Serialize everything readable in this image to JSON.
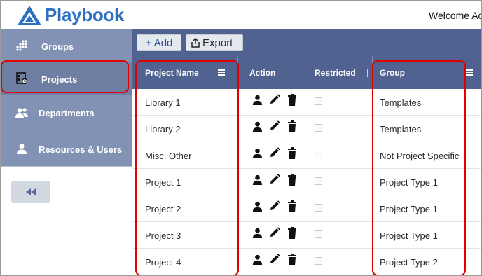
{
  "header": {
    "brand": "Playbook",
    "welcome": "Welcome Acc"
  },
  "sidebar": {
    "items": [
      {
        "label": "Groups",
        "icon": "groups-icon"
      },
      {
        "label": "Projects",
        "icon": "projects-icon"
      },
      {
        "label": "Departments",
        "icon": "departments-icon"
      },
      {
        "label": "Resources & Users",
        "icon": "user-icon"
      }
    ],
    "active": "Projects",
    "collapse_icon": "double-chevron-left-icon"
  },
  "toolbar": {
    "add_label": "+ Add",
    "export_label": "Export"
  },
  "table": {
    "columns": [
      "Project Name",
      "Action",
      "Restricted",
      "Group"
    ],
    "rows": [
      {
        "name": "Library 1",
        "group": "Templates"
      },
      {
        "name": "Library 2",
        "group": "Templates"
      },
      {
        "name": "Misc. Other",
        "group": "Not Project Specific"
      },
      {
        "name": "Project 1",
        "group": "Project Type 1"
      },
      {
        "name": "Project 2",
        "group": "Project Type 1"
      },
      {
        "name": "Project 3",
        "group": "Project Type 1"
      },
      {
        "name": "Project 4",
        "group": "Project Type 2"
      }
    ],
    "action_icons": [
      "user-icon",
      "pencil-icon",
      "trash-icon"
    ]
  },
  "colors": {
    "brand": "#2d6fc0",
    "sidebar": "#8192b4",
    "header_bar": "#4f6290",
    "highlight": "#e00000"
  }
}
